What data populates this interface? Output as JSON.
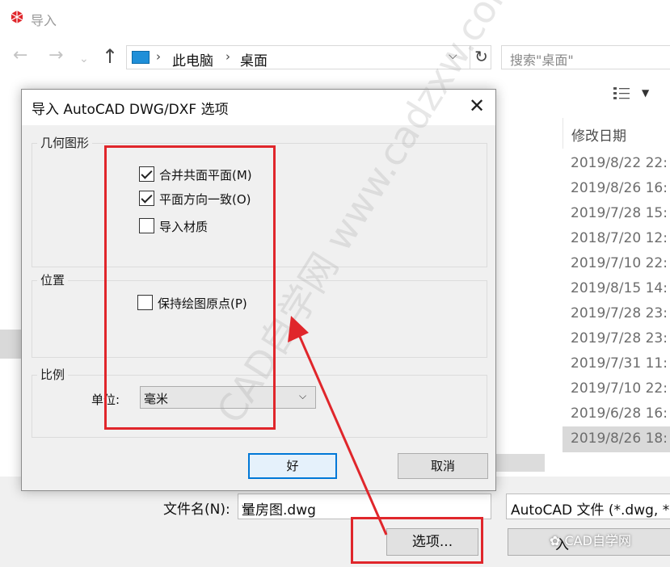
{
  "window": {
    "title": "导入"
  },
  "address": {
    "crumbs": [
      "此电脑",
      "桌面"
    ]
  },
  "search": {
    "placeholder": "搜索\"桌面\""
  },
  "file_list": {
    "column_header": "修改日期",
    "dates": [
      "2019/8/22 22:",
      "2019/8/26 16:",
      "2019/7/28 15:",
      "2018/7/20 12:",
      "2019/7/10 22:",
      "2019/8/15 14:",
      "2019/7/28 23:",
      "2019/7/28 23:",
      "2019/7/31 11:",
      "2019/7/10 22:",
      "2019/6/28 16:",
      "2019/8/26 18:"
    ]
  },
  "bottom_bar": {
    "filename_label": "文件名(N):",
    "filename_value": "量房图.dwg",
    "filetype_value": "AutoCAD 文件 (*.dwg, *",
    "options_button": "选项...",
    "import_button": "入"
  },
  "dialog": {
    "title": "导入 AutoCAD DWG/DXF 选项",
    "geometry": {
      "label": "几何图形",
      "merge_coplanar": {
        "label": "合并共面平面(M)",
        "checked": true
      },
      "orient_faces": {
        "label": "平面方向一致(O)",
        "checked": true
      },
      "import_materials": {
        "label": "导入材质",
        "checked": false
      }
    },
    "position": {
      "label": "位置",
      "preserve_origin": {
        "label": "保持绘图原点(P)",
        "checked": false
      }
    },
    "scale": {
      "label": "比例",
      "unit_label": "单位:",
      "unit_value": "毫米"
    },
    "ok_button": "好",
    "cancel_button": "取消"
  },
  "overlay": {
    "watermark": "CAD自学网 www.cadzxw.com",
    "wechat_tag": "CAD自学网"
  },
  "colors": {
    "annotation_red": "#e0262b",
    "focus_blue": "#0078d7",
    "pc_icon_blue": "#1f8fd8"
  }
}
